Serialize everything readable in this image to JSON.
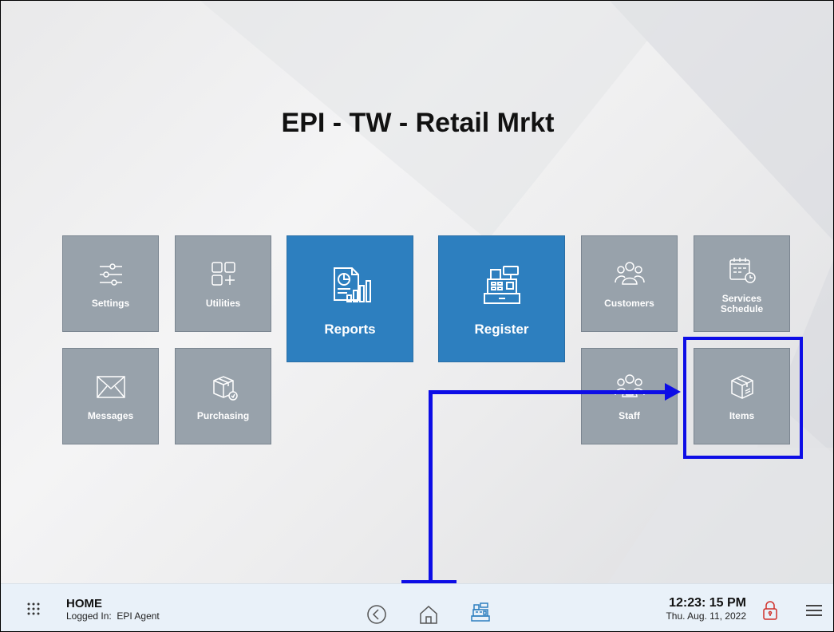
{
  "header": {
    "title": "EPI - TW - Retail Mrkt"
  },
  "tiles": {
    "settings": "Settings",
    "utilities": "Utilities",
    "reports": "Reports",
    "register": "Register",
    "customers": "Customers",
    "services_schedule": "Services Schedule",
    "messages": "Messages",
    "purchasing": "Purchasing",
    "staff": "Staff",
    "items": "Items"
  },
  "footer": {
    "screen": "HOME",
    "logged_in": "Logged In:  EPI Agent",
    "time": "12:23: 15 PM",
    "date": "Thu. Aug. 11, 2022"
  },
  "colors": {
    "tile_gray": "#98a2ab",
    "tile_blue": "#2d7fbf",
    "highlight": "#0d0de6",
    "lock_red": "#d0302a"
  },
  "icons": [
    "sliders-icon",
    "apps-add-icon",
    "report-chart-icon",
    "cash-register-icon",
    "users-group-icon",
    "calendar-clock-icon",
    "envelope-icon",
    "box-clock-icon",
    "staff-icon",
    "box-icon",
    "grid-dots-icon",
    "back-circle-icon",
    "home-icon",
    "register-small-icon",
    "lock-icon",
    "hamburger-icon"
  ]
}
